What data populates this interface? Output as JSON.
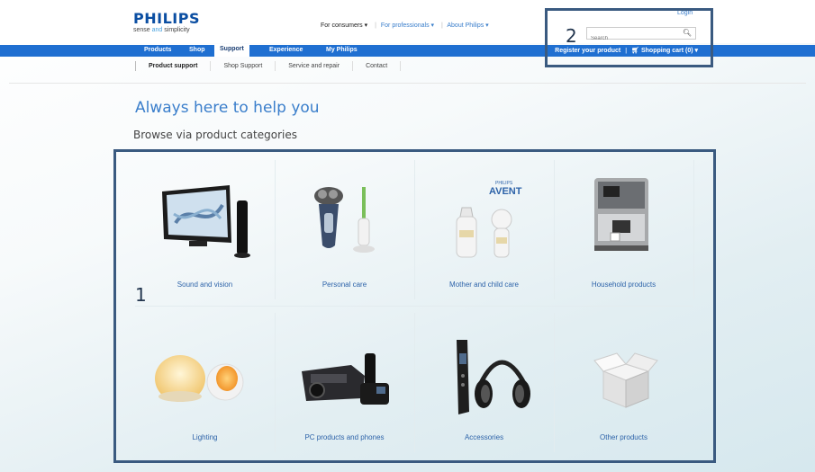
{
  "header": {
    "brand": "PHILIPS",
    "tagline_part1": "sense ",
    "tagline_and": "and",
    "tagline_part2": " simplicity",
    "audience": {
      "consumers": "For consumers ▾",
      "professionals": "For professionals ▾",
      "about": "About Philips ▾"
    },
    "login": "Login",
    "search_placeholder": "Search"
  },
  "nav": {
    "items": [
      "Products",
      "Shop",
      "Support",
      "Experience",
      "My Philips"
    ],
    "active": "Support",
    "register": "Register your product",
    "cart": "Shopping cart (0) ▾"
  },
  "subnav": [
    "Product support",
    "Shop Support",
    "Service and repair",
    "Contact"
  ],
  "main": {
    "headline": "Always here to help you",
    "subheadline": "Browse via product categories"
  },
  "categories": [
    {
      "label": "Sound and vision",
      "icon": "tv-icon"
    },
    {
      "label": "Personal care",
      "icon": "shaver-icon"
    },
    {
      "label": "Mother and child care",
      "icon": "baby-bottle-icon"
    },
    {
      "label": "Household products",
      "icon": "coffee-machine-icon"
    },
    {
      "label": "Lighting",
      "icon": "lamp-icon"
    },
    {
      "label": "PC products and phones",
      "icon": "projector-phone-icon"
    },
    {
      "label": "Accessories",
      "icon": "headphones-remote-icon"
    },
    {
      "label": "Other products",
      "icon": "box-icon"
    }
  ],
  "annotations": {
    "one": "1",
    "two": "2"
  },
  "colors": {
    "accent": "#1f6fd1",
    "link": "#2d63a9",
    "annotation_border": "#3a5a80"
  }
}
